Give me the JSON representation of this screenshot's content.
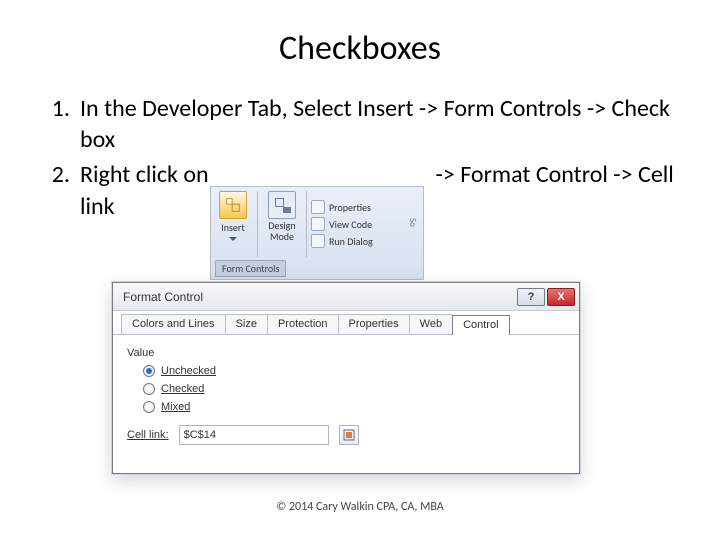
{
  "title": "Checkboxes",
  "list": {
    "n1": "1.",
    "t1": "In the Developer Tab, Select Insert -> Form Controls -> Check box",
    "n2": "2.",
    "t2a": "Right click on",
    "t2b": "-> Format Control -> Cell link"
  },
  "ribbon": {
    "insert": "Insert",
    "design": "Design Mode",
    "props": "Properties",
    "viewcode": "View Code",
    "rundlg": "Run Dialog",
    "group": "Form Controls",
    "so": "So"
  },
  "dialog": {
    "title": "Format Control",
    "help": "?",
    "close": "X",
    "tabs": {
      "colors": "Colors and Lines",
      "size": "Size",
      "protection": "Protection",
      "properties": "Properties",
      "web": "Web",
      "control": "Control"
    },
    "value_label": "Value",
    "unchecked": "Unchecked",
    "checked": "Checked",
    "mixed": "Mixed",
    "celllink_label": "Cell link:",
    "celllink_value": "$C$14"
  },
  "copyright": "© 2014 Cary Walkin CPA, CA, MBA"
}
